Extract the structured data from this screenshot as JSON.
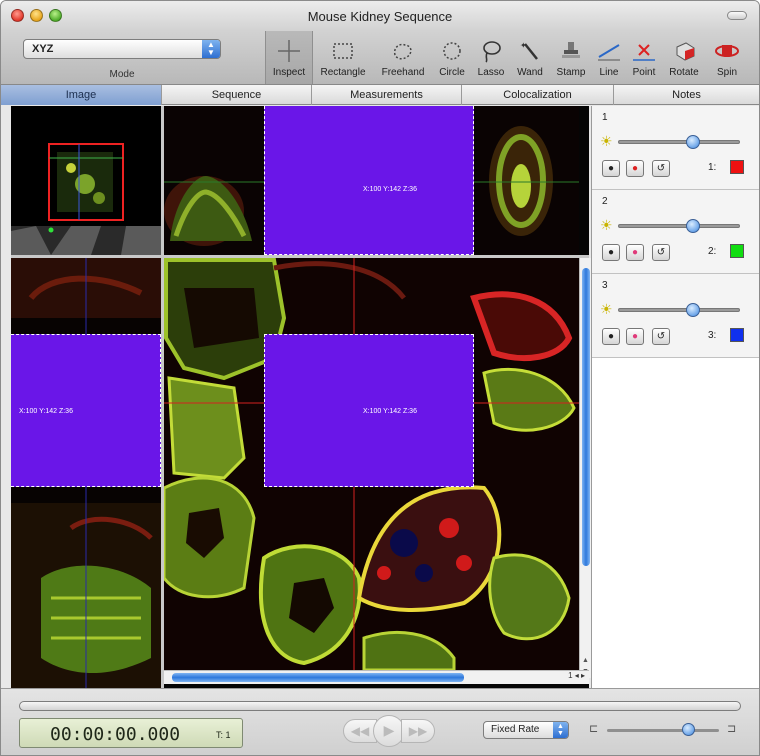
{
  "window": {
    "title": "Mouse Kidney Sequence"
  },
  "toolbar": {
    "mode": {
      "value": "XYZ",
      "label": "Mode"
    },
    "tools": [
      {
        "id": "inspect",
        "label": "Inspect",
        "icon": "crosshair-icon",
        "active": true
      },
      {
        "id": "rectangle",
        "label": "Rectangle",
        "icon": "rectangle-icon"
      },
      {
        "id": "freehand",
        "label": "Freehand",
        "icon": "freehand-icon"
      },
      {
        "id": "circle",
        "label": "Circle",
        "icon": "circle-icon"
      },
      {
        "id": "lasso",
        "label": "Lasso",
        "icon": "lasso-icon"
      },
      {
        "id": "wand",
        "label": "Wand",
        "icon": "wand-icon"
      },
      {
        "id": "stamp",
        "label": "Stamp",
        "icon": "stamp-icon"
      },
      {
        "id": "line",
        "label": "Line",
        "icon": "line-icon"
      },
      {
        "id": "point",
        "label": "Point",
        "icon": "point-icon"
      },
      {
        "id": "rotate",
        "label": "Rotate",
        "icon": "rotate-icon"
      },
      {
        "id": "spin",
        "label": "Spin",
        "icon": "spin-icon"
      }
    ]
  },
  "tabs": [
    "Image",
    "Sequence",
    "Measurements",
    "Colocalization",
    "Notes"
  ],
  "viewer": {
    "coord_top": "X:100 Y:142 Z:36",
    "coord_left": "X:100 Y:142 Z:36",
    "coord_main": "X:100 Y:142 Z:36",
    "page_indicator": "1 ◂ ▸"
  },
  "channels": [
    {
      "number": "1",
      "label": "1:",
      "color": "#ee1111",
      "level": 0.62
    },
    {
      "number": "2",
      "label": "2:",
      "color": "#11dd11",
      "level": 0.62
    },
    {
      "number": "3",
      "label": "3:",
      "color": "#1030ee",
      "level": 0.62
    }
  ],
  "playback": {
    "timecode": "00:00:00.000",
    "time_unit": "T: 1",
    "rate": "Fixed Rate",
    "speed_level": 0.72
  },
  "colors": {
    "selection": "#6a16e8",
    "accent": "#2e78dc"
  }
}
